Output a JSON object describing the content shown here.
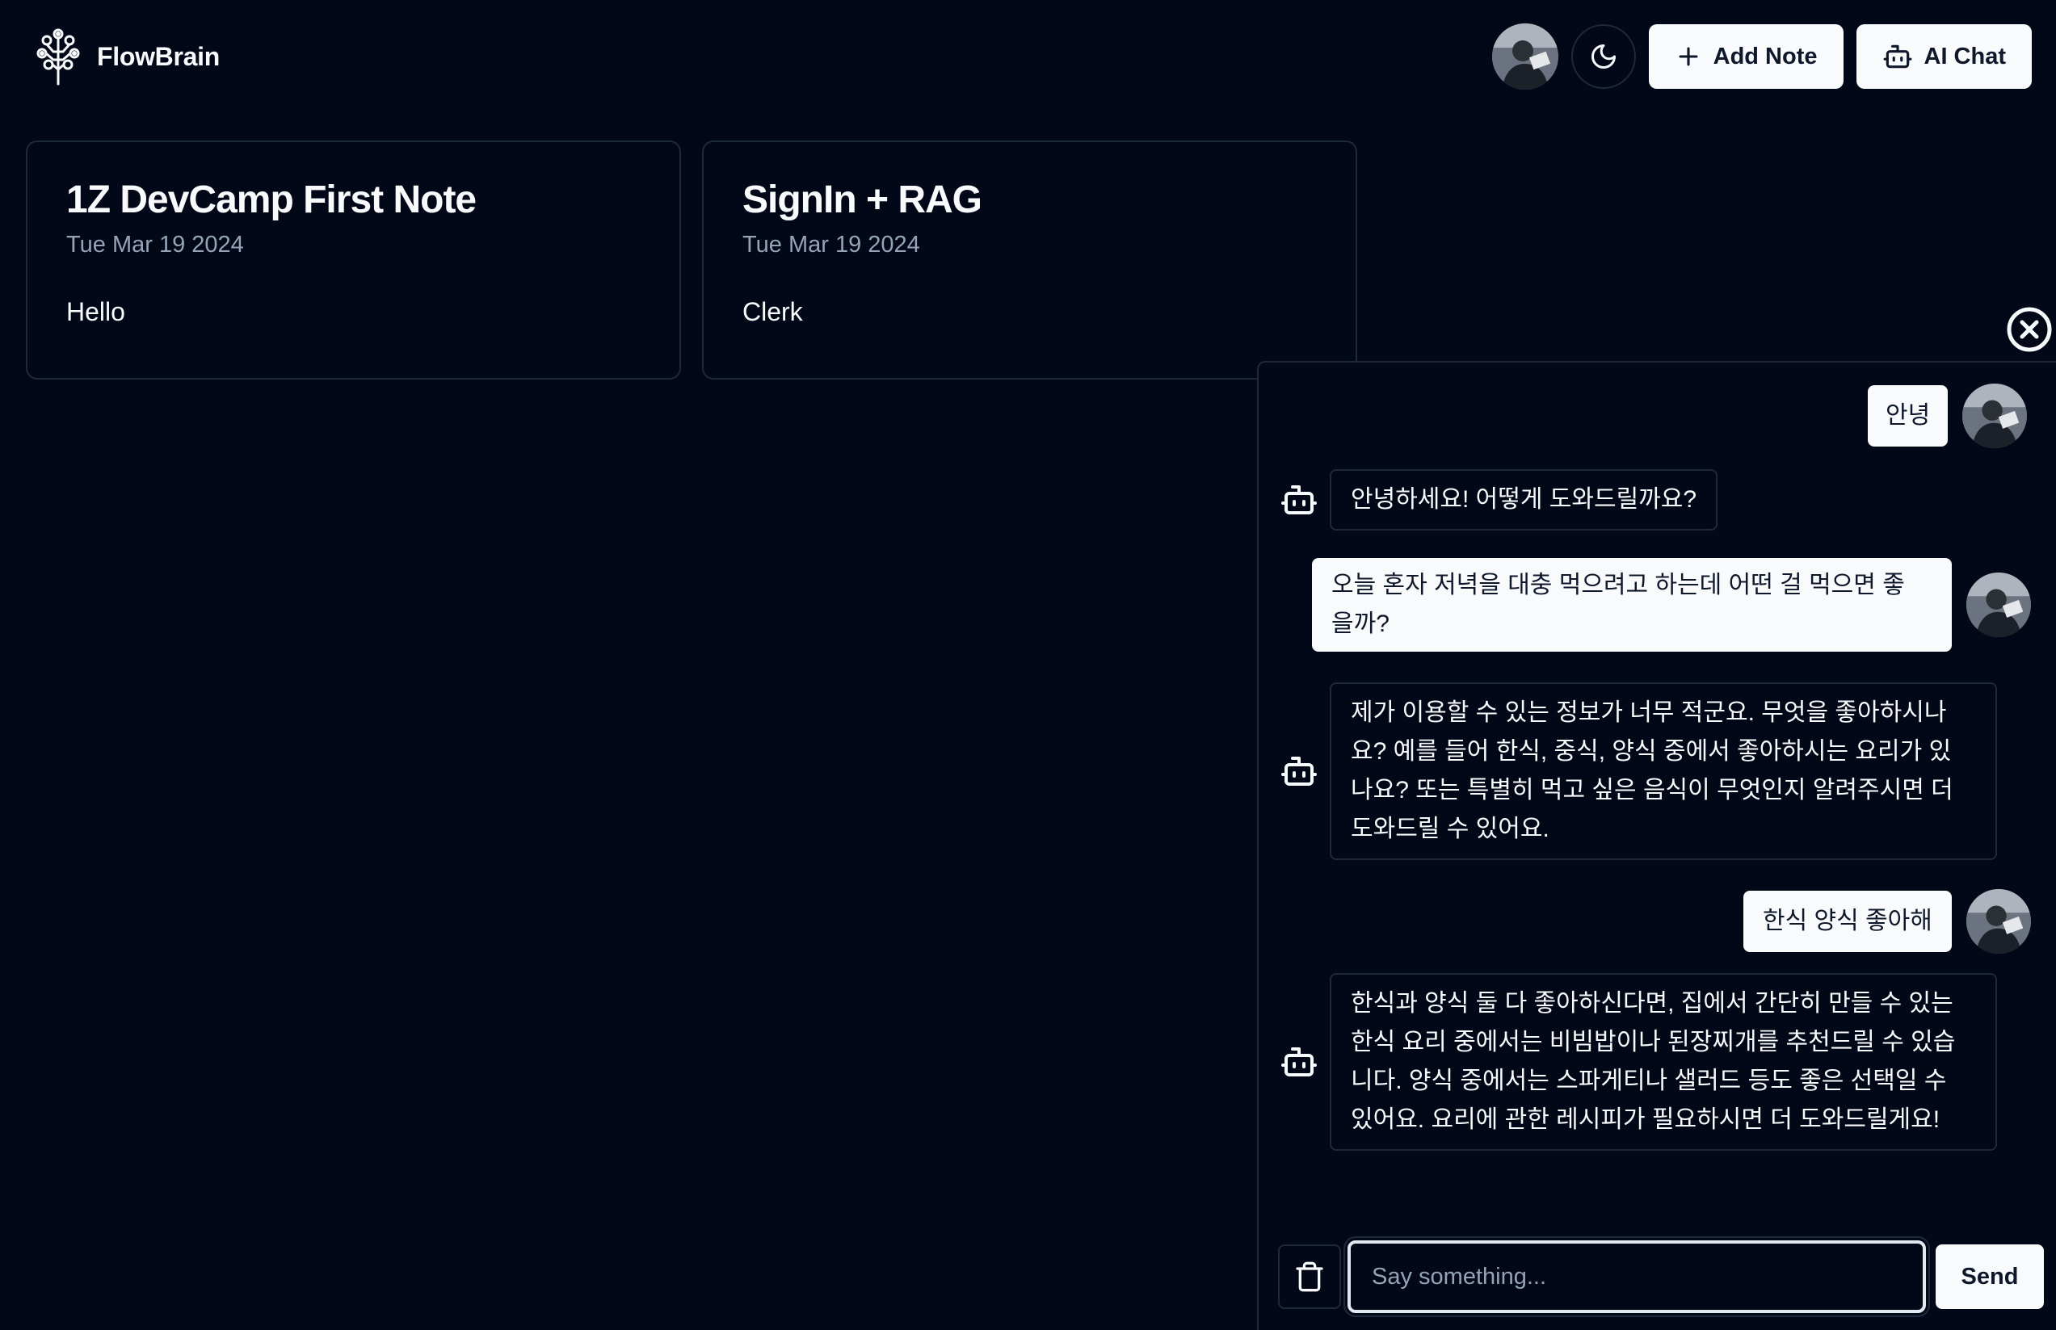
{
  "header": {
    "brand_name": "FlowBrain",
    "add_note_label": "Add Note",
    "ai_chat_label": "AI Chat"
  },
  "notes": [
    {
      "title": "1Z DevCamp First Note",
      "date": "Tue Mar 19 2024",
      "content": "Hello"
    },
    {
      "title": "SignIn + RAG",
      "date": "Tue Mar 19 2024",
      "content": "Clerk"
    }
  ],
  "chat": {
    "messages": [
      {
        "role": "user",
        "text": "안녕"
      },
      {
        "role": "assistant",
        "text": "안녕하세요! 어떻게 도와드릴까요?"
      },
      {
        "role": "user",
        "lines": [
          "오늘 혼자 저녁을 대충 먹으려고 하는데 어떤 걸 먹으면 좋",
          "을까?"
        ]
      },
      {
        "role": "assistant",
        "lines": [
          "제가 이용할 수 있는 정보가 너무 적군요. 무엇을 좋아하시나",
          "요? 예를 들어 한식, 중식, 양식 중에서 좋아하시는 요리가 있",
          "나요? 또는 특별히 먹고 싶은 음식이 무엇인지 알려주시면 더",
          "도와드릴 수 있어요."
        ]
      },
      {
        "role": "user",
        "text": "한식 양식 좋아해"
      },
      {
        "role": "assistant",
        "lines": [
          "한식과 양식 둘 다 좋아하신다면, 집에서 간단히 만들 수 있는",
          "한식 요리 중에서는 비빔밥이나 된장찌개를 추천드릴 수 있습",
          "니다. 양식 중에서는 스파게티나 샐러드 등도 좋은 선택일 수",
          "있어요. 요리에 관한 레시피가 필요하시면 더 도와드릴게요!"
        ]
      }
    ],
    "input_placeholder": "Say something...",
    "input_value": "",
    "send_label": "Send"
  },
  "colors": {
    "background": "#030818",
    "border": "#1e293b",
    "foreground": "#f8fafc",
    "muted": "#94a3b8"
  },
  "icons": [
    "brain-logo-icon",
    "moon-icon",
    "plus-icon",
    "bot-icon",
    "close-circle-icon",
    "trash-icon",
    "avatar"
  ]
}
